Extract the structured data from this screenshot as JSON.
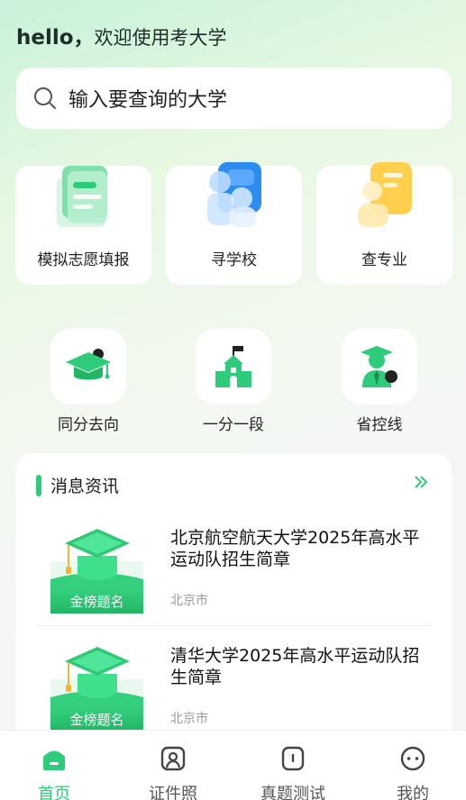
{
  "header": {
    "hello": "hello，",
    "welcome": "欢迎使用考大学"
  },
  "search": {
    "placeholder": "输入要查询的大学",
    "icon": "search-icon"
  },
  "big_cards": [
    {
      "label": "模拟志愿填报",
      "icon": "form-document-icon"
    },
    {
      "label": "寻学校",
      "icon": "school-people-icon"
    },
    {
      "label": "查专业",
      "icon": "major-profile-icon"
    }
  ],
  "small_items": [
    {
      "label": "同分去向",
      "icon": "graduation-cap-icon"
    },
    {
      "label": "一分一段",
      "icon": "school-building-icon"
    },
    {
      "label": "省控线",
      "icon": "graduate-person-icon"
    }
  ],
  "news": {
    "title": "消息资讯",
    "items": [
      {
        "title": "北京航空航天大学2025年高水平运动队招生简章",
        "location": "北京市",
        "thumb_label": "金榜题名"
      },
      {
        "title": "清华大学2025年高水平运动队招生简章",
        "location": "北京市",
        "thumb_label": "金榜题名"
      }
    ]
  },
  "tabbar": [
    {
      "label": "首页",
      "icon": "home-icon",
      "active": true
    },
    {
      "label": "证件照",
      "icon": "id-photo-icon",
      "active": false
    },
    {
      "label": "真题测试",
      "icon": "test-icon",
      "active": false
    },
    {
      "label": "我的",
      "icon": "profile-icon",
      "active": false
    }
  ],
  "colors": {
    "accent": "#2ecc7a",
    "text": "#222222",
    "muted": "#999999"
  }
}
